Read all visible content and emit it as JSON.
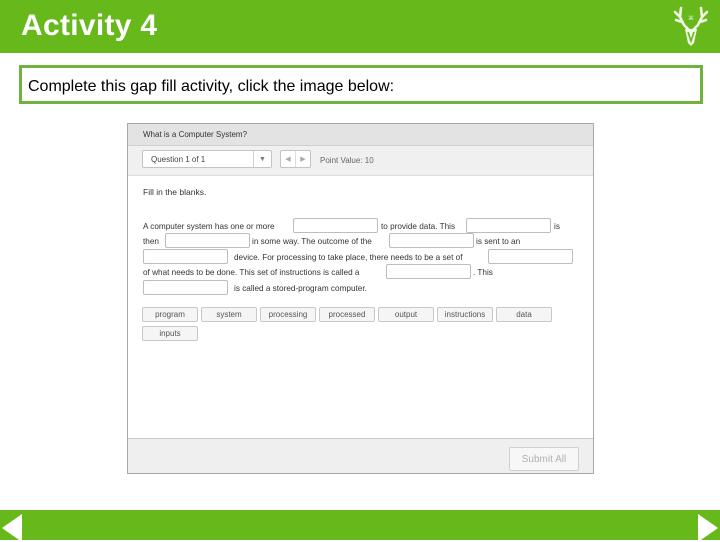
{
  "slide": {
    "title": "Activity 4",
    "instruction": "Complete this gap fill activity, click the image below:"
  },
  "colors": {
    "brand_green": "#67b81a",
    "box_border": "#6eb33f"
  },
  "quiz": {
    "title": "What is a Computer System?",
    "question_selector": "Question 1 of 1",
    "pager_prev": "◀",
    "pager_next": "▶",
    "point_value": "Point Value: 10",
    "prompt": "Fill in the blanks.",
    "passage": {
      "l1a": "A computer system has one or more",
      "l1b": "to provide data. This",
      "l1c": "is",
      "l2a": "then",
      "l2b": "in some way. The outcome of the",
      "l2c": "is sent to an",
      "l3a": "device. For processing to take place, there needs to be a set of",
      "l4a": "of what needs to be done. This set of instructions is called a",
      "l4b": ". This",
      "l5a": "is called a stored-program computer."
    },
    "blanks": [
      "",
      "",
      "",
      "",
      "",
      "",
      "",
      ""
    ],
    "word_bank": [
      "program",
      "system",
      "processing",
      "processed",
      "output",
      "instructions",
      "data",
      "inputs"
    ],
    "submit_label": "Submit All"
  },
  "icons": {
    "logo": "deer-antlers-logo",
    "prev": "triangle-left-icon",
    "next": "triangle-right-icon"
  }
}
